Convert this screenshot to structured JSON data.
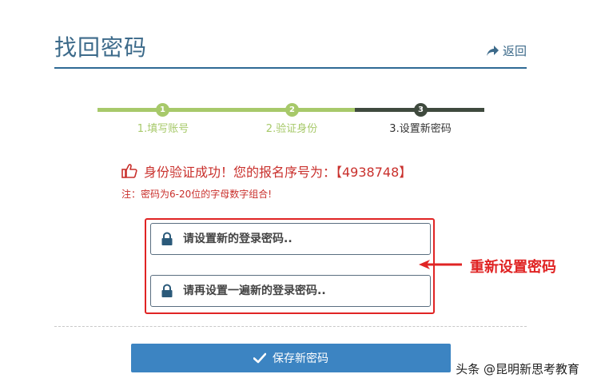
{
  "header": {
    "title": "找回密码",
    "back_label": "返回"
  },
  "steps": [
    {
      "number": "1",
      "label": "1.填写账号",
      "state": "done"
    },
    {
      "number": "2",
      "label": "2.验证身份",
      "state": "done"
    },
    {
      "number": "3",
      "label": "3.设置新密码",
      "state": "active"
    }
  ],
  "message": {
    "success_text": "身份验证成功！您的报名序号为：【4938748】",
    "note_text": "注：密码为6-20位的字母数字组合!"
  },
  "form": {
    "new_password_placeholder": "请设置新的登录密码..",
    "confirm_password_placeholder": "请再设置一遍新的登录密码..",
    "save_label": "保存新密码"
  },
  "annotation": {
    "text": "重新设置密码"
  },
  "watermark": "头条 @昆明新思考教育",
  "colors": {
    "accent_blue": "#3c84c2",
    "title_blue": "#3c6a8a",
    "step_done": "#a7c96a",
    "step_active": "#3f4a3e",
    "alert_red": "#e02424"
  },
  "icons": [
    "back-arrow-icon",
    "thumbs-up-icon",
    "lock-icon",
    "check-icon",
    "right-pointing-arrow-icon"
  ]
}
